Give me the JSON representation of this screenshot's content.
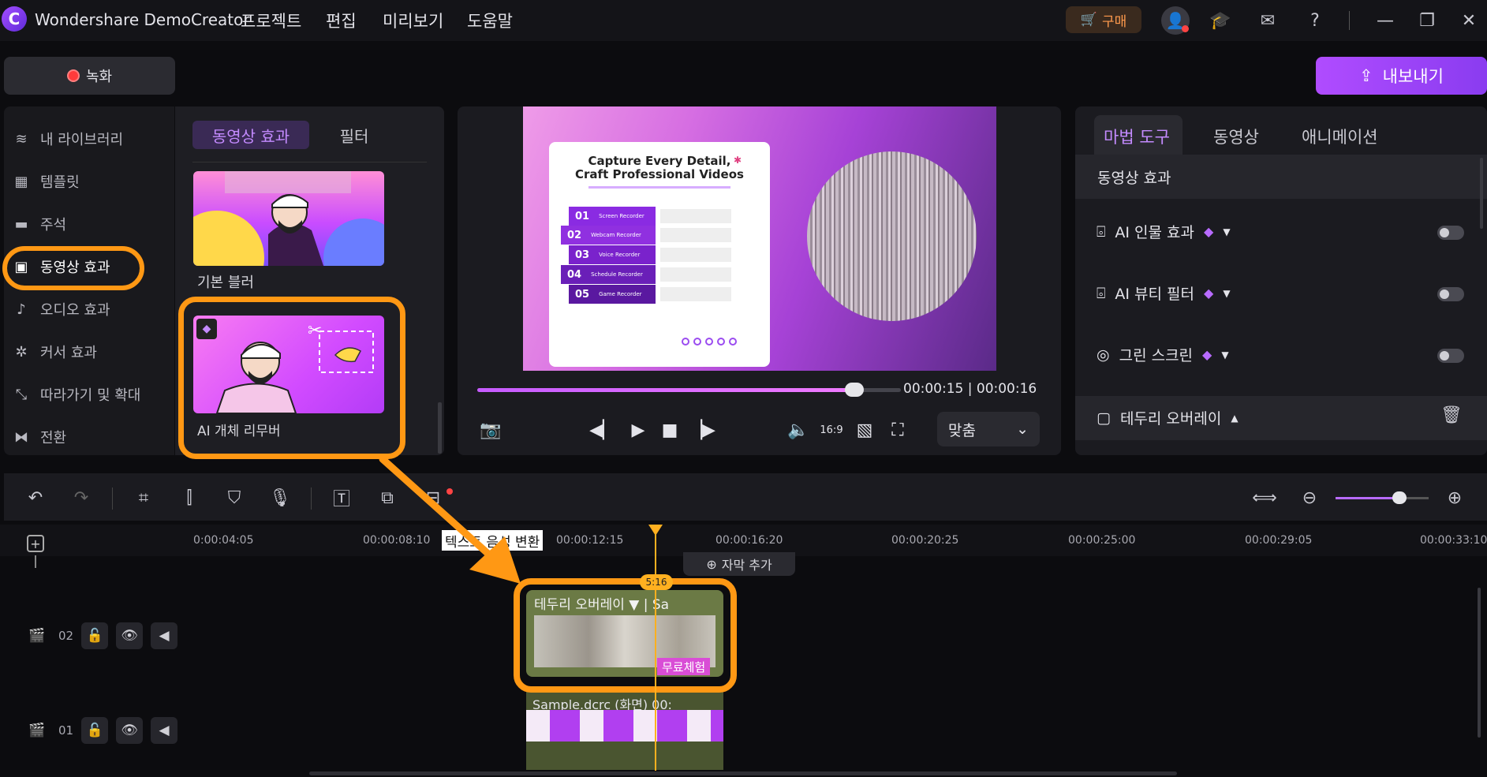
{
  "app": {
    "title": "Wondershare DemoCreator",
    "logo": "C"
  },
  "menu": [
    "프로젝트",
    "편집",
    "미리보기",
    "도움말"
  ],
  "topbar": {
    "buy_label": "구매"
  },
  "record_label": "녹화",
  "export_label": "내보내기",
  "nav": [
    {
      "label": "내 라이브러리",
      "icon": "layers-icon"
    },
    {
      "label": "템플릿",
      "icon": "template-icon"
    },
    {
      "label": "주석",
      "icon": "annotation-icon"
    },
    {
      "label": "동영상 효과",
      "icon": "video-effect-icon"
    },
    {
      "label": "오디오 효과",
      "icon": "audio-effect-icon"
    },
    {
      "label": "커서 효과",
      "icon": "cursor-effect-icon"
    },
    {
      "label": "따라가기 및 확대",
      "icon": "zoom-follow-icon"
    },
    {
      "label": "전환",
      "icon": "transition-icon"
    }
  ],
  "library": {
    "tabs": [
      "동영상 효과",
      "필터"
    ],
    "items": [
      {
        "label": "기본 블러"
      },
      {
        "label": "AI 개체 리무버"
      }
    ]
  },
  "slide": {
    "title_line1": "Capture Every Detail,",
    "title_line2": "Craft Professional Videos",
    "rows": [
      "01",
      "02",
      "03",
      "04",
      "05"
    ],
    "row_labels": [
      "Screen Recorder",
      "Webcam Recorder",
      "Voice Recorder",
      "Schedule Recorder",
      "Game Recorder"
    ]
  },
  "player": {
    "time": "00:00:15 | 00:00:16",
    "fit_label": "맞춤",
    "progress_fraction": 0.89
  },
  "props": {
    "tabs": [
      "마법 도구",
      "동영상",
      "애니메이션"
    ],
    "section": "동영상 효과",
    "rows": [
      {
        "label": "AI 인물 효과"
      },
      {
        "label": "AI 뷰티 필터"
      },
      {
        "label": "그린 스크린"
      },
      {
        "label": "테두리 오버레이"
      }
    ]
  },
  "timeline": {
    "ticks": [
      "0:00:04:05",
      "00:00:08:10",
      "00:00:12:15",
      "00:00:16:20",
      "00:00:20:25",
      "00:00:25:00",
      "00:00:29:05",
      "00:00:33:10"
    ],
    "tts_label": "텍스트 음성 변환",
    "add_caption": "자막 추가",
    "tracks": [
      {
        "id": "02"
      },
      {
        "id": "01"
      }
    ],
    "clip2_label": "테두리 오버레이 ▼ | Sa",
    "clip2_badge": "무료체험",
    "clip1_label": "Sample.dcrc (화면)  00:",
    "playhead_badge": "5:16"
  },
  "colors": {
    "accent": "#b86bff",
    "highlight": "#ff9814",
    "playhead": "#ffb020"
  }
}
